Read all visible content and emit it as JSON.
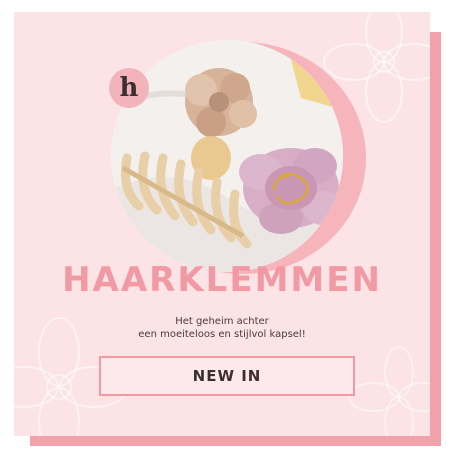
{
  "banner": {
    "logo_letter": "h",
    "headline": "HAARKLEMMEN",
    "tagline_line1": "Het geheim achter",
    "tagline_line2": "een moeiteloos en stijlvol kapsel!",
    "cta_label": "NEW IN"
  },
  "colors": {
    "background": "#fbe3e6",
    "shadow": "#f1a3ab",
    "accent": "#f19aa4",
    "text_dark": "#3b2f31"
  },
  "icons": [
    "logo-h-icon",
    "flower-decoration-icon"
  ]
}
